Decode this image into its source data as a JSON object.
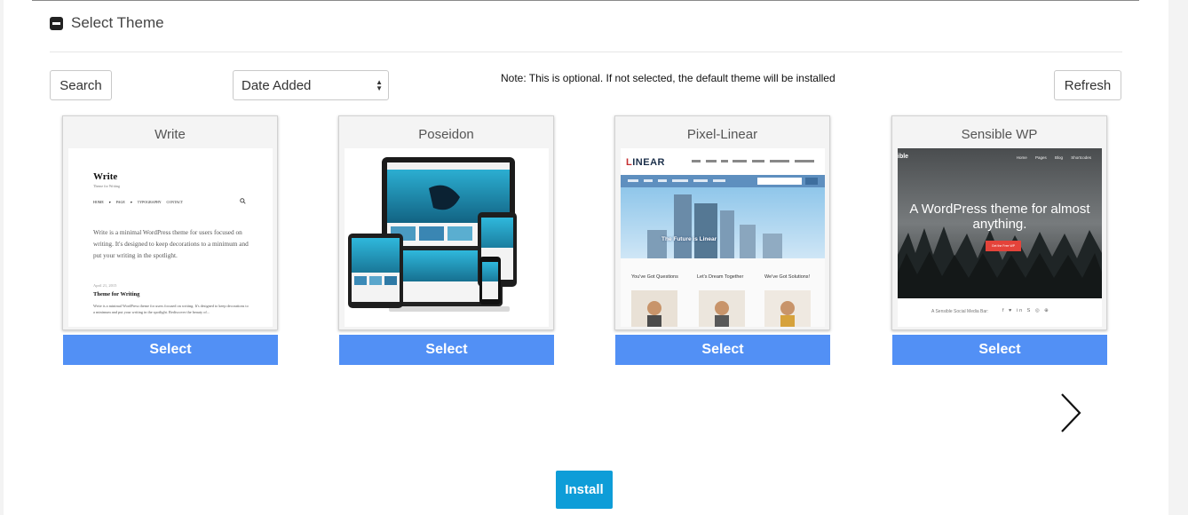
{
  "section": {
    "title": "Select Theme",
    "collapse_icon": "minus-square-icon"
  },
  "toolbar": {
    "search_label": "Search",
    "sort_selected": "Date Added",
    "note": "Note: This is optional. If not selected, the default theme will be installed",
    "refresh_label": "Refresh"
  },
  "themes": [
    {
      "name": "Write",
      "select_label": "Select",
      "preview": {
        "site_title": "Write",
        "tagline": "Theme for Writing",
        "nav": "HOME ▾ PAGE ▾ TYPOGRAPHY CONTACT",
        "intro": "Write is a minimal WordPress theme for users focused on writing. It's designed to keep decorations to a minimum and put your writing in the spotlight.",
        "post_date": "April 21, 2015",
        "post_title": "Theme for Writing",
        "post_excerpt": "Write is a minimal WordPress theme for users focused on writing. It's designed to keep decorations to a minimum and put your writing in the spotlight. Rediscover the beauty of..."
      }
    },
    {
      "name": "Poseidon",
      "select_label": "Select",
      "preview": {}
    },
    {
      "name": "Pixel-Linear",
      "select_label": "Select",
      "preview": {
        "logo_first": "L",
        "logo_rest": "INEAR",
        "hero_caption": "The Future is Linear",
        "columns": [
          "You've Got Questions",
          "Let's Dream Together",
          "We've Got Solutions!"
        ]
      }
    },
    {
      "name": "Sensible WP",
      "select_label": "Select",
      "preview": {
        "brand": "ible",
        "nav": "Home Pages Blog Shortcodes",
        "headline": "A WordPress theme for almost anything.",
        "cta": "Get the Free WP",
        "footer": "A Sensible Social Media Bar:",
        "social": "f ♥ in S ◎ ⊕"
      }
    }
  ],
  "carousel": {
    "next_icon": "chevron-right-icon"
  },
  "install_label": "Install",
  "colors": {
    "select_button": "#5290f5",
    "install_button": "#0e9dd8"
  }
}
